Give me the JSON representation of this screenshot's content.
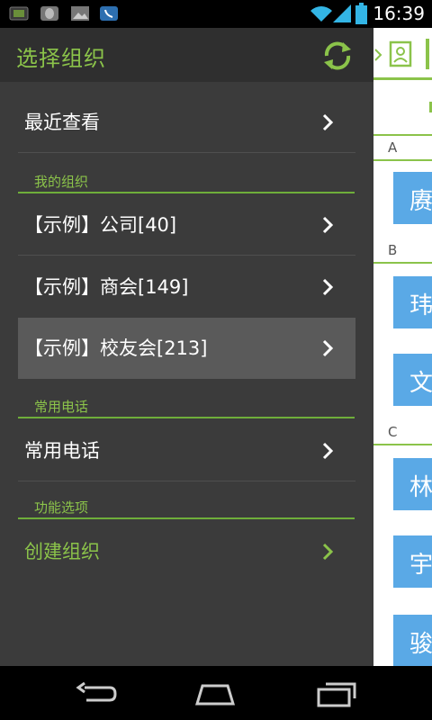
{
  "status_bar": {
    "time": "16:39"
  },
  "drawer": {
    "title": "选择组织",
    "items": [
      {
        "label": "最近查看"
      },
      {
        "label": "【示例】公司[40]"
      },
      {
        "label": "【示例】商会[149]"
      },
      {
        "label": "【示例】校友会[213]"
      },
      {
        "label": "常用电话"
      },
      {
        "label": "创建组织"
      }
    ],
    "sections": [
      {
        "label": "我的组织"
      },
      {
        "label": "常用电话"
      },
      {
        "label": "功能选项"
      }
    ]
  },
  "content": {
    "letters": [
      "A",
      "B",
      "C"
    ],
    "contacts": [
      "赓",
      "玮",
      "文",
      "林",
      "宇",
      "骏"
    ]
  },
  "colors": {
    "accent": "#8bc34a",
    "avatar": "#5aa9e6"
  }
}
